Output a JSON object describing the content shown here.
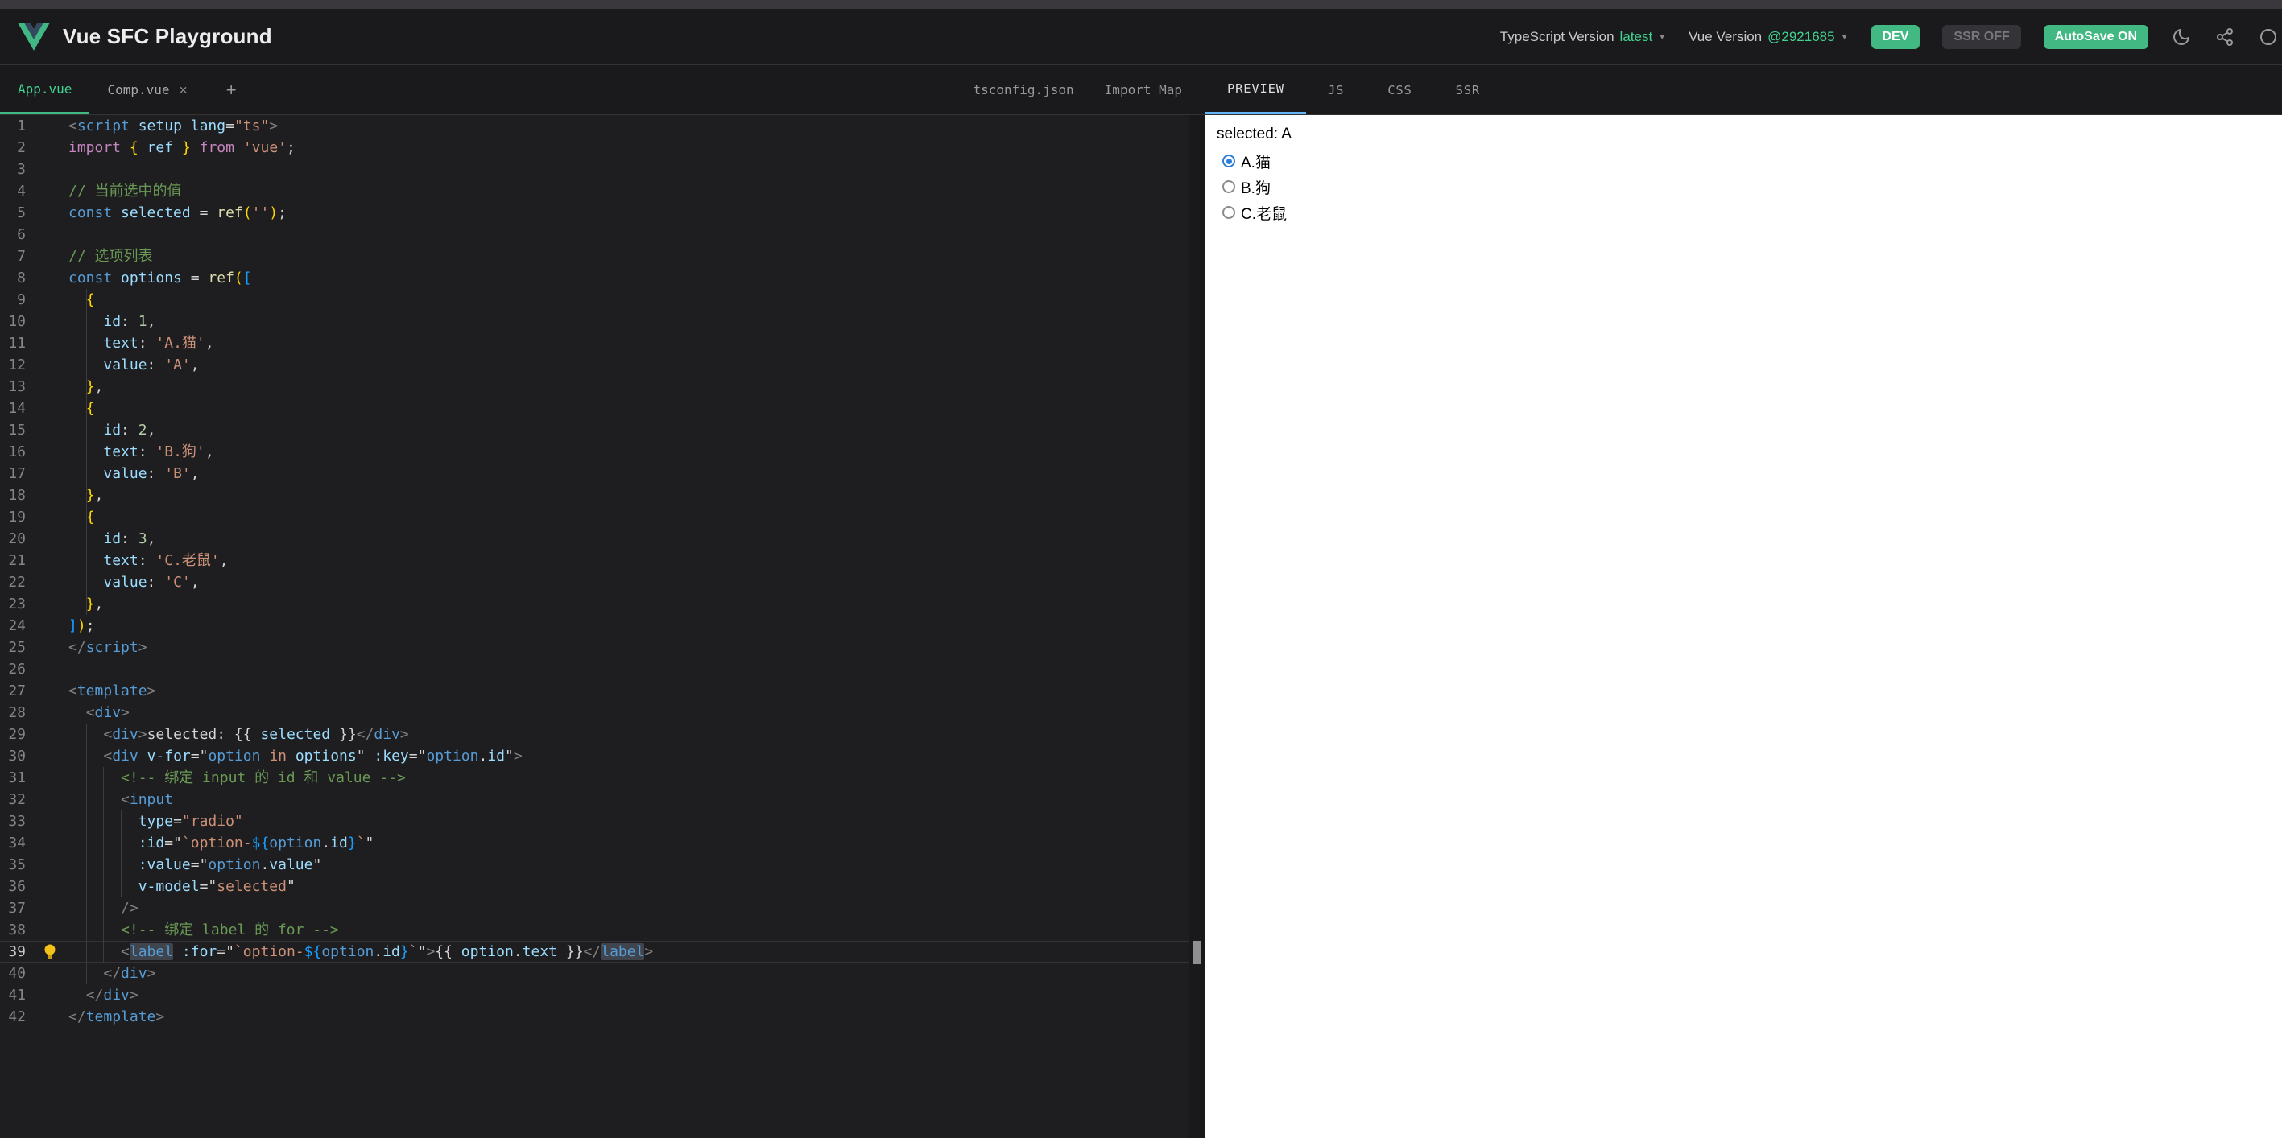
{
  "header": {
    "title": "Vue SFC Playground",
    "ts_label": "TypeScript Version",
    "ts_value": "latest",
    "vue_label": "Vue Version",
    "vue_value": "@2921685",
    "dev_toggle": "DEV",
    "ssr_toggle": "SSR OFF",
    "autosave_toggle": "AutoSave ON",
    "icons": [
      "moon-icon",
      "share-icon",
      "download-icon"
    ]
  },
  "file_tabs": {
    "tabs": [
      {
        "label": "App.vue",
        "active": true,
        "closable": false
      },
      {
        "label": "Comp.vue",
        "active": false,
        "closable": true
      }
    ],
    "add_label": "+",
    "right_items": [
      "tsconfig.json",
      "Import Map"
    ]
  },
  "output_tabs": [
    {
      "label": "PREVIEW",
      "active": true
    },
    {
      "label": "JS",
      "active": false
    },
    {
      "label": "CSS",
      "active": false
    },
    {
      "label": "SSR",
      "active": false
    }
  ],
  "colors": {
    "accent_green": "#42b883",
    "accent_green_text": "#42d392",
    "output_tab_underline": "#64b5f6",
    "radio_blue": "#2b7dd9",
    "editor_bg": "#1e1e20",
    "header_bg": "#1a1a1c"
  },
  "editor": {
    "active_line": 39,
    "lines": [
      {
        "n": 1,
        "t": [
          [
            "tb",
            "<"
          ],
          [
            "tag",
            "script"
          ],
          [
            "pn",
            " "
          ],
          [
            "attr",
            "setup"
          ],
          [
            "pn",
            " "
          ],
          [
            "attr",
            "lang"
          ],
          [
            "pn",
            "="
          ],
          [
            "str",
            "\"ts\""
          ],
          [
            "tb",
            ">"
          ]
        ]
      },
      {
        "n": 2,
        "t": [
          [
            "kw2",
            "import"
          ],
          [
            "pn",
            " "
          ],
          [
            "b1",
            "{"
          ],
          [
            "pn",
            " "
          ],
          [
            "attr",
            "ref"
          ],
          [
            "pn",
            " "
          ],
          [
            "b1",
            "}"
          ],
          [
            "pn",
            " "
          ],
          [
            "kw2",
            "from"
          ],
          [
            "pn",
            " "
          ],
          [
            "str",
            "'vue'"
          ],
          [
            "pn",
            ";"
          ]
        ]
      },
      {
        "n": 3,
        "t": []
      },
      {
        "n": 4,
        "t": [
          [
            "cm",
            "// 当前选中的值"
          ]
        ]
      },
      {
        "n": 5,
        "t": [
          [
            "kw",
            "const"
          ],
          [
            "pn",
            " "
          ],
          [
            "attr",
            "selected"
          ],
          [
            "pn",
            " = "
          ],
          [
            "fn",
            "ref"
          ],
          [
            "b1",
            "("
          ],
          [
            "str",
            "''"
          ],
          [
            "b1",
            ")"
          ],
          [
            "pn",
            ";"
          ]
        ]
      },
      {
        "n": 6,
        "t": []
      },
      {
        "n": 7,
        "t": [
          [
            "cm",
            "// 选项列表"
          ]
        ]
      },
      {
        "n": 8,
        "t": [
          [
            "kw",
            "const"
          ],
          [
            "pn",
            " "
          ],
          [
            "attr",
            "options"
          ],
          [
            "pn",
            " = "
          ],
          [
            "fn",
            "ref"
          ],
          [
            "b1",
            "("
          ],
          [
            "b2",
            "["
          ]
        ]
      },
      {
        "n": 9,
        "t": [
          [
            "ws",
            "  "
          ],
          [
            "b1",
            "{"
          ]
        ]
      },
      {
        "n": 10,
        "t": [
          [
            "ws",
            "    "
          ],
          [
            "attr",
            "id"
          ],
          [
            "pn",
            ": "
          ],
          [
            "num",
            "1"
          ],
          [
            "pn",
            ","
          ]
        ]
      },
      {
        "n": 11,
        "t": [
          [
            "ws",
            "    "
          ],
          [
            "attr",
            "text"
          ],
          [
            "pn",
            ": "
          ],
          [
            "str",
            "'A.猫'"
          ],
          [
            "pn",
            ","
          ]
        ]
      },
      {
        "n": 12,
        "t": [
          [
            "ws",
            "    "
          ],
          [
            "attr",
            "value"
          ],
          [
            "pn",
            ": "
          ],
          [
            "str",
            "'A'"
          ],
          [
            "pn",
            ","
          ]
        ]
      },
      {
        "n": 13,
        "t": [
          [
            "ws",
            "  "
          ],
          [
            "b1",
            "}"
          ],
          [
            "pn",
            ","
          ]
        ]
      },
      {
        "n": 14,
        "t": [
          [
            "ws",
            "  "
          ],
          [
            "b1",
            "{"
          ]
        ]
      },
      {
        "n": 15,
        "t": [
          [
            "ws",
            "    "
          ],
          [
            "attr",
            "id"
          ],
          [
            "pn",
            ": "
          ],
          [
            "num",
            "2"
          ],
          [
            "pn",
            ","
          ]
        ]
      },
      {
        "n": 16,
        "t": [
          [
            "ws",
            "    "
          ],
          [
            "attr",
            "text"
          ],
          [
            "pn",
            ": "
          ],
          [
            "str",
            "'B.狗'"
          ],
          [
            "pn",
            ","
          ]
        ]
      },
      {
        "n": 17,
        "t": [
          [
            "ws",
            "    "
          ],
          [
            "attr",
            "value"
          ],
          [
            "pn",
            ": "
          ],
          [
            "str",
            "'B'"
          ],
          [
            "pn",
            ","
          ]
        ]
      },
      {
        "n": 18,
        "t": [
          [
            "ws",
            "  "
          ],
          [
            "b1",
            "}"
          ],
          [
            "pn",
            ","
          ]
        ]
      },
      {
        "n": 19,
        "t": [
          [
            "ws",
            "  "
          ],
          [
            "b1",
            "{"
          ]
        ]
      },
      {
        "n": 20,
        "t": [
          [
            "ws",
            "    "
          ],
          [
            "attr",
            "id"
          ],
          [
            "pn",
            ": "
          ],
          [
            "num",
            "3"
          ],
          [
            "pn",
            ","
          ]
        ]
      },
      {
        "n": 21,
        "t": [
          [
            "ws",
            "    "
          ],
          [
            "attr",
            "text"
          ],
          [
            "pn",
            ": "
          ],
          [
            "str",
            "'C.老鼠'"
          ],
          [
            "pn",
            ","
          ]
        ]
      },
      {
        "n": 22,
        "t": [
          [
            "ws",
            "    "
          ],
          [
            "attr",
            "value"
          ],
          [
            "pn",
            ": "
          ],
          [
            "str",
            "'C'"
          ],
          [
            "pn",
            ","
          ]
        ]
      },
      {
        "n": 23,
        "t": [
          [
            "ws",
            "  "
          ],
          [
            "b1",
            "}"
          ],
          [
            "pn",
            ","
          ]
        ]
      },
      {
        "n": 24,
        "t": [
          [
            "b2",
            "]"
          ],
          [
            "b1",
            ")"
          ],
          [
            "pn",
            ";"
          ]
        ]
      },
      {
        "n": 25,
        "t": [
          [
            "tb",
            "</"
          ],
          [
            "tag",
            "script"
          ],
          [
            "tb",
            ">"
          ]
        ]
      },
      {
        "n": 26,
        "t": []
      },
      {
        "n": 27,
        "t": [
          [
            "tb",
            "<"
          ],
          [
            "tag",
            "template"
          ],
          [
            "tb",
            ">"
          ]
        ]
      },
      {
        "n": 28,
        "t": [
          [
            "ws",
            "  "
          ],
          [
            "tb",
            "<"
          ],
          [
            "tag",
            "div"
          ],
          [
            "tb",
            ">"
          ]
        ]
      },
      {
        "n": 29,
        "t": [
          [
            "ws",
            "    "
          ],
          [
            "tb",
            "<"
          ],
          [
            "tag",
            "div"
          ],
          [
            "tb",
            ">"
          ],
          [
            "pn",
            "selected: {{ "
          ],
          [
            "attr",
            "selected"
          ],
          [
            "pn",
            " }}"
          ],
          [
            "tb",
            "</"
          ],
          [
            "tag",
            "div"
          ],
          [
            "tb",
            ">"
          ]
        ]
      },
      {
        "n": 30,
        "t": [
          [
            "ws",
            "    "
          ],
          [
            "tb",
            "<"
          ],
          [
            "tag",
            "div"
          ],
          [
            "pn",
            " "
          ],
          [
            "attr",
            "v-for"
          ],
          [
            "pn",
            "=\""
          ],
          [
            "kw",
            "option"
          ],
          [
            "pn",
            " "
          ],
          [
            "str",
            "in"
          ],
          [
            "pn",
            " "
          ],
          [
            "attr",
            "options"
          ],
          [
            "pn",
            "\" "
          ],
          [
            "attr",
            ":key"
          ],
          [
            "pn",
            "=\""
          ],
          [
            "kw",
            "option"
          ],
          [
            "pn",
            "."
          ],
          [
            "attr",
            "id"
          ],
          [
            "pn",
            "\""
          ],
          [
            "tb",
            ">"
          ]
        ]
      },
      {
        "n": 31,
        "t": [
          [
            "ws",
            "      "
          ],
          [
            "cm",
            "<!-- 绑定 input 的 id 和 value -->"
          ]
        ]
      },
      {
        "n": 32,
        "t": [
          [
            "ws",
            "      "
          ],
          [
            "tb",
            "<"
          ],
          [
            "tag",
            "input"
          ]
        ]
      },
      {
        "n": 33,
        "t": [
          [
            "ws",
            "        "
          ],
          [
            "attr",
            "type"
          ],
          [
            "pn",
            "="
          ],
          [
            "str",
            "\"radio\""
          ]
        ]
      },
      {
        "n": 34,
        "t": [
          [
            "ws",
            "        "
          ],
          [
            "attr",
            ":id"
          ],
          [
            "pn",
            "=\""
          ],
          [
            "str",
            "`option-"
          ],
          [
            "b2",
            "${"
          ],
          [
            "kw",
            "option"
          ],
          [
            "pn",
            "."
          ],
          [
            "attr",
            "id"
          ],
          [
            "b2",
            "}"
          ],
          [
            "str",
            "`"
          ],
          [
            "pn",
            "\""
          ]
        ]
      },
      {
        "n": 35,
        "t": [
          [
            "ws",
            "        "
          ],
          [
            "attr",
            ":value"
          ],
          [
            "pn",
            "=\""
          ],
          [
            "kw",
            "option"
          ],
          [
            "pn",
            "."
          ],
          [
            "attr",
            "value"
          ],
          [
            "pn",
            "\""
          ]
        ]
      },
      {
        "n": 36,
        "t": [
          [
            "ws",
            "        "
          ],
          [
            "attr",
            "v-model"
          ],
          [
            "pn",
            "=\""
          ],
          [
            "str",
            "selected"
          ],
          [
            "pn",
            "\""
          ]
        ]
      },
      {
        "n": 37,
        "t": [
          [
            "ws",
            "      "
          ],
          [
            "tb",
            "/>"
          ]
        ]
      },
      {
        "n": 38,
        "t": [
          [
            "ws",
            "      "
          ],
          [
            "cm",
            "<!-- 绑定 label 的 for -->"
          ]
        ]
      },
      {
        "n": 39,
        "t": [
          [
            "ws",
            "      "
          ],
          [
            "tb",
            "<"
          ],
          [
            "tag hl",
            "label"
          ],
          [
            "pn",
            " "
          ],
          [
            "attr",
            ":for"
          ],
          [
            "pn",
            "=\""
          ],
          [
            "str",
            "`option-"
          ],
          [
            "b2",
            "${"
          ],
          [
            "kw",
            "option"
          ],
          [
            "pn",
            "."
          ],
          [
            "attr",
            "id"
          ],
          [
            "b2",
            "}"
          ],
          [
            "str",
            "`"
          ],
          [
            "pn",
            "\""
          ],
          [
            "tb",
            ">"
          ],
          [
            "pn",
            "{{ "
          ],
          [
            "attr",
            "option"
          ],
          [
            "pn",
            "."
          ],
          [
            "attr",
            "text"
          ],
          [
            "pn",
            " }}"
          ],
          [
            "tb",
            "</"
          ],
          [
            "tag hl",
            "label"
          ],
          [
            "tb",
            ">"
          ]
        ]
      },
      {
        "n": 40,
        "t": [
          [
            "ws",
            "    "
          ],
          [
            "tb",
            "</"
          ],
          [
            "tag",
            "div"
          ],
          [
            "tb",
            ">"
          ]
        ]
      },
      {
        "n": 41,
        "t": [
          [
            "ws",
            "  "
          ],
          [
            "tb",
            "</"
          ],
          [
            "tag",
            "div"
          ],
          [
            "tb",
            ">"
          ]
        ]
      },
      {
        "n": 42,
        "t": [
          [
            "tb",
            "</"
          ],
          [
            "tag",
            "template"
          ],
          [
            "tb",
            ">"
          ]
        ]
      }
    ]
  },
  "preview": {
    "selected_text": "selected: A",
    "options": [
      {
        "label": "A.猫",
        "checked": true
      },
      {
        "label": "B.狗",
        "checked": false
      },
      {
        "label": "C.老鼠",
        "checked": false
      }
    ]
  }
}
